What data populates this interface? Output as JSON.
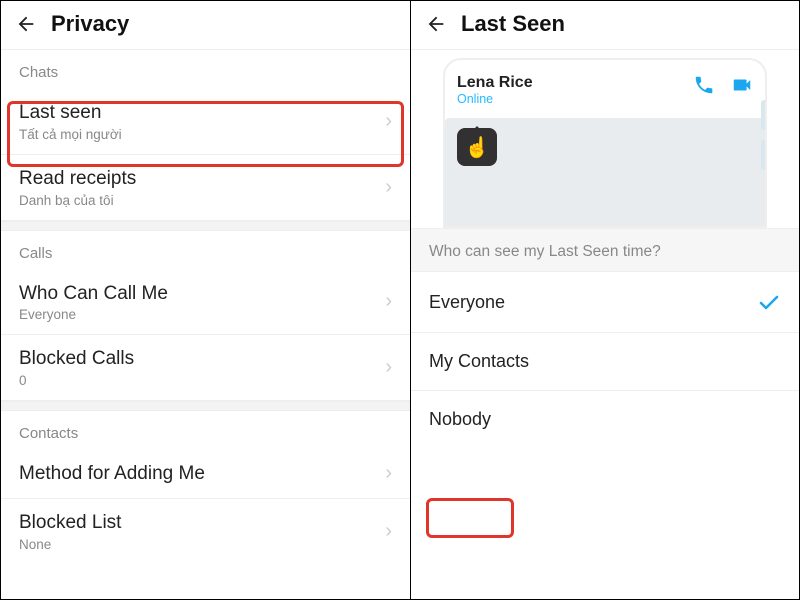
{
  "left": {
    "title": "Privacy",
    "sections": {
      "chats_label": "Chats",
      "calls_label": "Calls",
      "contacts_label": "Contacts"
    },
    "rows": {
      "last_seen": {
        "title": "Last seen",
        "sub": "Tất cả mọi người"
      },
      "read": {
        "title": "Read receipts",
        "sub": "Danh bạ của tôi"
      },
      "who_call": {
        "title": "Who Can Call Me",
        "sub": "Everyone"
      },
      "blocked_c": {
        "title": "Blocked Calls",
        "sub": "0"
      },
      "adding": {
        "title": "Method for Adding Me",
        "sub": ""
      },
      "blocked_l": {
        "title": "Blocked List",
        "sub": "None"
      }
    }
  },
  "right": {
    "title": "Last Seen",
    "preview": {
      "name": "Lena Rice",
      "status": "Online",
      "hand": "☝"
    },
    "question": "Who can see my Last Seen time?",
    "options": {
      "everyone": "Everyone",
      "contacts": "My Contacts",
      "nobody": "Nobody"
    },
    "selected": "everyone"
  }
}
